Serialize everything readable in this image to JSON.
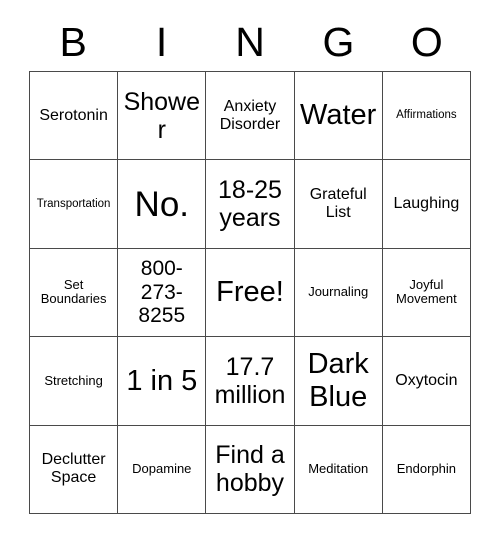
{
  "card": {
    "title_letters": [
      "B",
      "I",
      "N",
      "G",
      "O"
    ],
    "colors": {
      "background": "#ffffff",
      "text": "#000000",
      "grid_line": "#4a4a4a"
    },
    "grid": {
      "rows": 5,
      "columns": 5,
      "free_space": "Free!",
      "cells": [
        {
          "text": "Serotonin",
          "size": "sm"
        },
        {
          "text": "Shower",
          "size": "lg"
        },
        {
          "text": "Anxiety Disorder",
          "size": "sm"
        },
        {
          "text": "Water",
          "size": "xl"
        },
        {
          "text": "Affirmations",
          "size": "xxs"
        },
        {
          "text": "Transportation",
          "size": "xxs"
        },
        {
          "text": "No.",
          "size": "xxl"
        },
        {
          "text": "18-25 years",
          "size": "lg"
        },
        {
          "text": "Grateful List",
          "size": "sm"
        },
        {
          "text": "Laughing",
          "size": "sm"
        },
        {
          "text": "Set Boundaries",
          "size": "xs"
        },
        {
          "text": "800-273-8255",
          "size": "md"
        },
        {
          "text": "Free!",
          "size": "xl"
        },
        {
          "text": "Journaling",
          "size": "xs"
        },
        {
          "text": "Joyful Movement",
          "size": "xs"
        },
        {
          "text": "Stretching",
          "size": "xs"
        },
        {
          "text": "1 in 5",
          "size": "xl"
        },
        {
          "text": "17.7 million",
          "size": "lg"
        },
        {
          "text": "Dark Blue",
          "size": "xl"
        },
        {
          "text": "Oxytocin",
          "size": "sm"
        },
        {
          "text": "Declutter Space",
          "size": "sm"
        },
        {
          "text": "Dopamine",
          "size": "xs"
        },
        {
          "text": "Find a hobby",
          "size": "lg"
        },
        {
          "text": "Meditation",
          "size": "xs"
        },
        {
          "text": "Endorphin",
          "size": "xs"
        }
      ]
    }
  }
}
